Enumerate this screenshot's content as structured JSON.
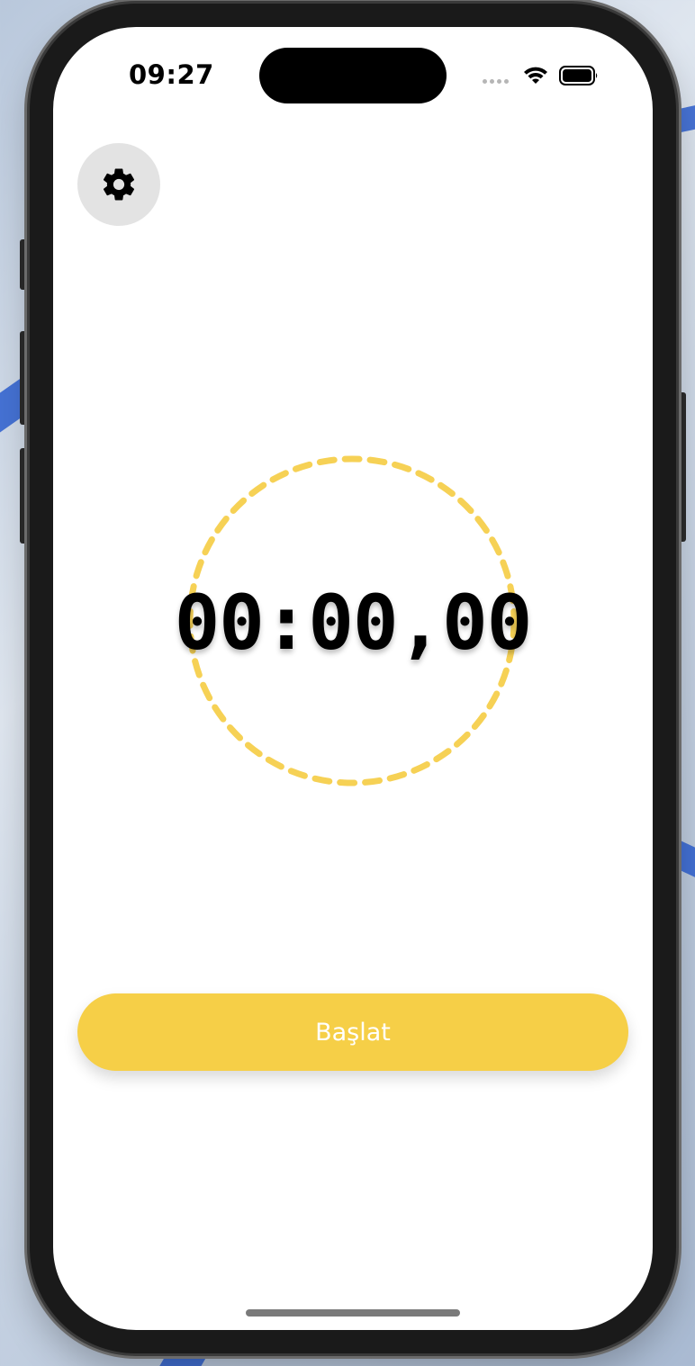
{
  "status_bar": {
    "time": "09:27",
    "signal_icon": "cellular-signal-icon",
    "wifi_icon": "wifi-icon",
    "battery_icon": "battery-icon"
  },
  "toolbar": {
    "settings_icon": "gear-icon"
  },
  "timer": {
    "display": "00:00,00",
    "ring_color": "#f6d155"
  },
  "actions": {
    "start_label": "Başlat",
    "start_color": "#f6cf47"
  }
}
